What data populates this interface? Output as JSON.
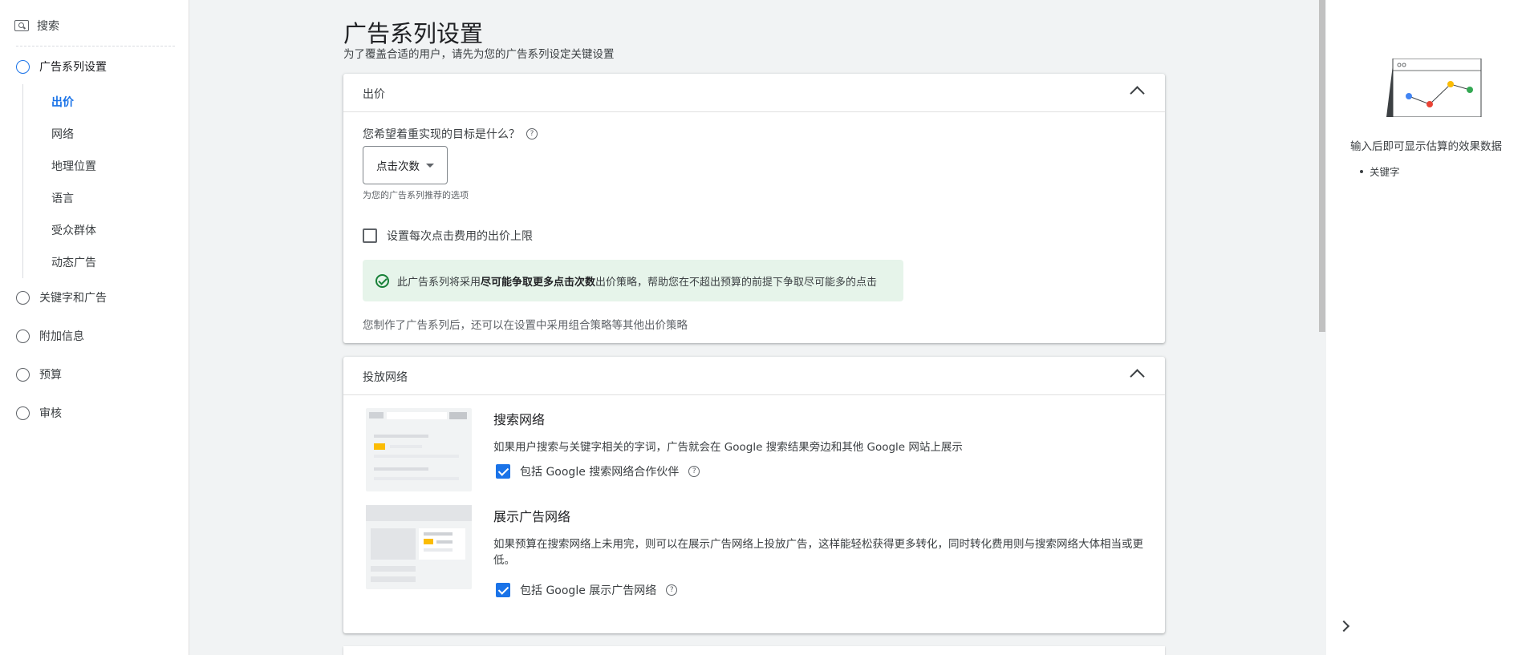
{
  "sidebar": {
    "search_label": "搜索",
    "steps": [
      {
        "label": "广告系列设置"
      },
      {
        "label": "关键字和广告"
      },
      {
        "label": "附加信息"
      },
      {
        "label": "预算"
      },
      {
        "label": "审核"
      }
    ],
    "subitems": [
      {
        "label": "出价"
      },
      {
        "label": "网络"
      },
      {
        "label": "地理位置"
      },
      {
        "label": "语言"
      },
      {
        "label": "受众群体"
      },
      {
        "label": "动态广告"
      }
    ]
  },
  "header": {
    "title": "广告系列设置",
    "subtitle": "为了覆盖合适的用户，请先为您的广告系列设定关键设置"
  },
  "bidding": {
    "title": "出价",
    "question": "您希望着重实现的目标是什么？",
    "goal_selected": "点击次数",
    "hint": "为您的广告系列推荐的选项",
    "cpc_limit_label": "设置每次点击费用的出价上限",
    "info_prefix": "此广告系列将采用",
    "info_strategy": "尽可能争取更多点击次数",
    "info_suffix": "出价策略，帮助您在不超出预算的前提下争取尽可能多的点击",
    "footnote": "您制作了广告系列后，还可以在设置中采用组合策略等其他出价策略"
  },
  "networks": {
    "title": "投放网络",
    "search": {
      "title": "搜索网络",
      "description": "如果用户搜索与关键字相关的字词，广告就会在 Google 搜索结果旁边和其他 Google 网站上展示",
      "checkbox_label": "包括 Google 搜索网络合作伙伴",
      "checked": true
    },
    "display": {
      "title": "展示广告网络",
      "description": "如果预算在搜索网络上未用完，则可以在展示广告网络上投放广告，这样能轻松获得更多转化，同时转化费用则与搜索网络大体相当或更低。",
      "checkbox_label": "包括 Google 展示广告网络",
      "checked": true
    }
  },
  "right_panel": {
    "message": "输入后即可显示估算的效果数据",
    "bullets": [
      "关键字"
    ]
  },
  "colors": {
    "accent": "#1a73e8",
    "success_bg": "#e6f4ea",
    "success": "#188038",
    "highlight": "#fbbc04"
  }
}
